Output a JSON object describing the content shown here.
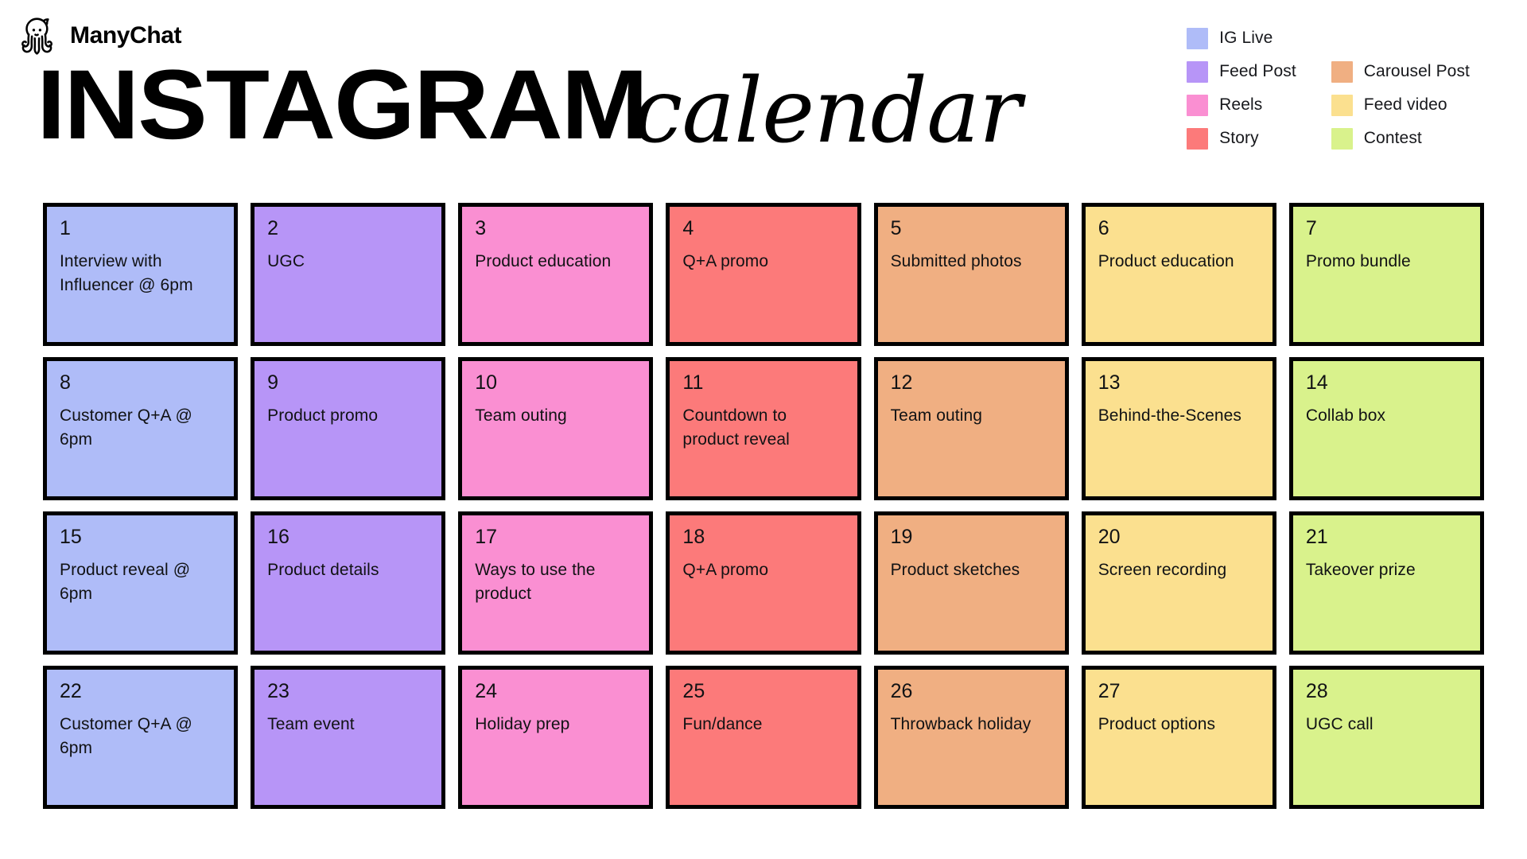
{
  "brand": {
    "name": "ManyChat",
    "logo_icon": "manychat-octopus-logo"
  },
  "title": {
    "main": "INSTAGRAM",
    "script": "calendar"
  },
  "legend": {
    "items": [
      {
        "label": "IG Live",
        "color": "#AFBCF8",
        "column": 1,
        "row": 1
      },
      {
        "label": "Feed Post",
        "color": "#B795F7",
        "column": 1,
        "row": 2
      },
      {
        "label": "Reels",
        "color": "#FA8FD2",
        "column": 1,
        "row": 3
      },
      {
        "label": "Story",
        "color": "#FC7A7A",
        "column": 1,
        "row": 4
      },
      {
        "label": "Carousel Post",
        "color": "#F0AF82",
        "column": 2,
        "row": 2
      },
      {
        "label": "Feed video",
        "color": "#FBE08F",
        "column": 2,
        "row": 3
      },
      {
        "label": "Contest",
        "color": "#D9F28C",
        "column": 2,
        "row": 4
      }
    ]
  },
  "calendar": {
    "columns": [
      {
        "category": "IG Live",
        "color": "#AFBCF8"
      },
      {
        "category": "Feed Post",
        "color": "#B795F7"
      },
      {
        "category": "Reels",
        "color": "#FA8FD2"
      },
      {
        "category": "Story",
        "color": "#FC7A7A"
      },
      {
        "category": "Carousel Post",
        "color": "#F0AF82"
      },
      {
        "category": "Feed video",
        "color": "#FBE08F"
      },
      {
        "category": "Contest",
        "color": "#D9F28C"
      }
    ],
    "days": [
      {
        "day": "1",
        "event": "Interview with Influencer @ 6pm",
        "color": "#AFBCF8"
      },
      {
        "day": "2",
        "event": "UGC",
        "color": "#B795F7"
      },
      {
        "day": "3",
        "event": "Product education",
        "color": "#FA8FD2"
      },
      {
        "day": "4",
        "event": "Q+A promo",
        "color": "#FC7A7A"
      },
      {
        "day": "5",
        "event": "Submitted photos",
        "color": "#F0AF82"
      },
      {
        "day": "6",
        "event": "Product education",
        "color": "#FBE08F"
      },
      {
        "day": "7",
        "event": "Promo bundle",
        "color": "#D9F28C"
      },
      {
        "day": "8",
        "event": "Customer Q+A @ 6pm",
        "color": "#AFBCF8"
      },
      {
        "day": "9",
        "event": "Product promo",
        "color": "#B795F7"
      },
      {
        "day": "10",
        "event": "Team outing",
        "color": "#FA8FD2"
      },
      {
        "day": "11",
        "event": "Countdown to product reveal",
        "color": "#FC7A7A"
      },
      {
        "day": "12",
        "event": "Team outing",
        "color": "#F0AF82"
      },
      {
        "day": "13",
        "event": "Behind-the-Scenes",
        "color": "#FBE08F"
      },
      {
        "day": "14",
        "event": "Collab box",
        "color": "#D9F28C"
      },
      {
        "day": "15",
        "event": "Product reveal @ 6pm",
        "color": "#AFBCF8"
      },
      {
        "day": "16",
        "event": "Product details",
        "color": "#B795F7"
      },
      {
        "day": "17",
        "event": "Ways to use the product",
        "color": "#FA8FD2"
      },
      {
        "day": "18",
        "event": "Q+A promo",
        "color": "#FC7A7A"
      },
      {
        "day": "19",
        "event": "Product sketches",
        "color": "#F0AF82"
      },
      {
        "day": "20",
        "event": "Screen recording",
        "color": "#FBE08F"
      },
      {
        "day": "21",
        "event": "Takeover prize",
        "color": "#D9F28C"
      },
      {
        "day": "22",
        "event": "Customer Q+A @ 6pm",
        "color": "#AFBCF8"
      },
      {
        "day": "23",
        "event": "Team event",
        "color": "#B795F7"
      },
      {
        "day": "24",
        "event": "Holiday prep",
        "color": "#FA8FD2"
      },
      {
        "day": "25",
        "event": "Fun/dance",
        "color": "#FC7A7A"
      },
      {
        "day": "26",
        "event": "Throwback holiday",
        "color": "#F0AF82"
      },
      {
        "day": "27",
        "event": "Product options",
        "color": "#FBE08F"
      },
      {
        "day": "28",
        "event": "UGC call",
        "color": "#D9F28C"
      }
    ]
  }
}
